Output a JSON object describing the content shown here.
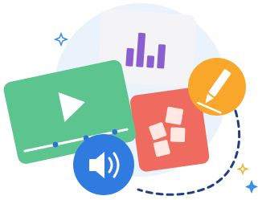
{
  "illustration": {
    "colors": {
      "background_circle": "#eaf2fb",
      "chart_card": "#f4f4f6",
      "bar_chart": "#8b5fd0",
      "video_card": "#5cc48f",
      "video_card_dark": "#46a877",
      "play_button": "#ffffff",
      "progress_track": "#ffffff",
      "progress_dots": "#2f6fd8",
      "grid_card": "#f06b5f",
      "grid_tiles": "#ffe7e2",
      "pencil_circle": "#f9a72a",
      "pencil": "#ffffff",
      "speaker_circle": "#2f7be0",
      "speaker": "#ffffff",
      "dashed_path": "#1f3e86",
      "sparkle_blue": "#3d8fe8",
      "sparkle_gold": "#f2b23a"
    },
    "chart_levels": [
      0.45,
      0.85,
      0.3,
      0.6
    ],
    "video_progress": 0.88,
    "icons": [
      "play-icon",
      "bar-chart-icon",
      "tile-grid-icon",
      "pencil-icon",
      "speaker-icon",
      "sparkle-icon"
    ]
  }
}
